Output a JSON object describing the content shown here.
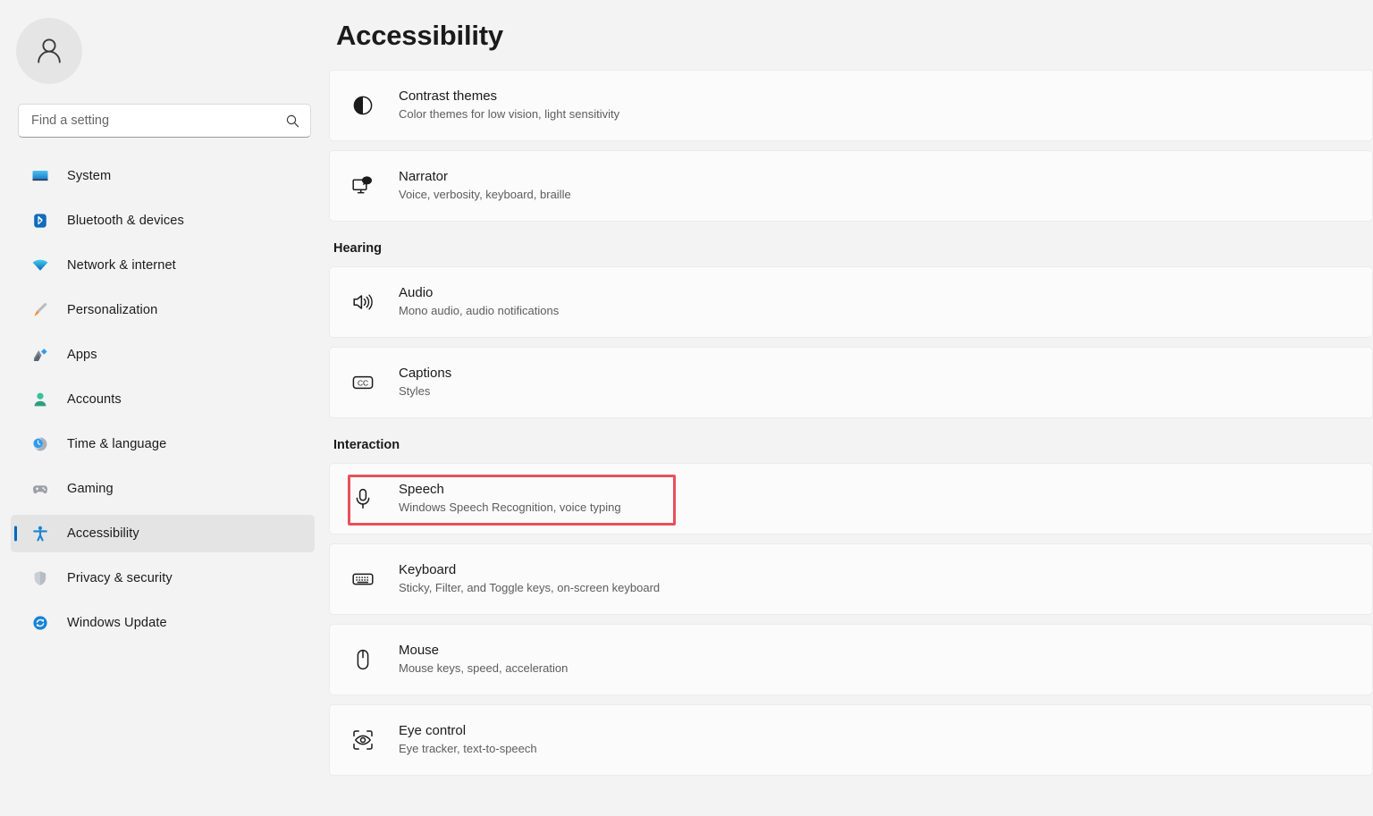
{
  "sidebar": {
    "avatar_icon": "person-avatar-icon",
    "search": {
      "placeholder": "Find a setting",
      "value": "",
      "icon": "search-icon"
    },
    "items": [
      {
        "label": "System",
        "icon": "monitor-icon",
        "selected": false
      },
      {
        "label": "Bluetooth & devices",
        "icon": "bluetooth-icon",
        "selected": false
      },
      {
        "label": "Network & internet",
        "icon": "wifi-icon",
        "selected": false
      },
      {
        "label": "Personalization",
        "icon": "paintbrush-icon",
        "selected": false
      },
      {
        "label": "Apps",
        "icon": "apps-icon",
        "selected": false
      },
      {
        "label": "Accounts",
        "icon": "account-person-icon",
        "selected": false
      },
      {
        "label": "Time & language",
        "icon": "clock-globe-icon",
        "selected": false
      },
      {
        "label": "Gaming",
        "icon": "gamepad-icon",
        "selected": false
      },
      {
        "label": "Accessibility",
        "icon": "accessibility-person-icon",
        "selected": true
      },
      {
        "label": "Privacy & security",
        "icon": "shield-icon",
        "selected": false
      },
      {
        "label": "Windows Update",
        "icon": "update-refresh-icon",
        "selected": false
      }
    ]
  },
  "main": {
    "title": "Accessibility",
    "groups": [
      {
        "header": "",
        "cards": [
          {
            "title": "Contrast themes",
            "subtitle": "Color themes for low vision, light sensitivity",
            "icon": "contrast-circle-icon",
            "highlighted": false
          },
          {
            "title": "Narrator",
            "subtitle": "Voice, verbosity, keyboard, braille",
            "icon": "narrator-monitor-speech-icon",
            "highlighted": false
          }
        ]
      },
      {
        "header": "Hearing",
        "cards": [
          {
            "title": "Audio",
            "subtitle": "Mono audio, audio notifications",
            "icon": "speaker-volume-icon",
            "highlighted": false
          },
          {
            "title": "Captions",
            "subtitle": "Styles",
            "icon": "closed-caption-icon",
            "highlighted": false
          }
        ]
      },
      {
        "header": "Interaction",
        "cards": [
          {
            "title": "Speech",
            "subtitle": "Windows Speech Recognition, voice typing",
            "icon": "microphone-icon",
            "highlighted": true
          },
          {
            "title": "Keyboard",
            "subtitle": "Sticky, Filter, and Toggle keys, on-screen keyboard",
            "icon": "keyboard-icon",
            "highlighted": false
          },
          {
            "title": "Mouse",
            "subtitle": "Mouse keys, speed, acceleration",
            "icon": "mouse-icon",
            "highlighted": false
          },
          {
            "title": "Eye control",
            "subtitle": "Eye tracker, text-to-speech",
            "icon": "eye-control-icon",
            "highlighted": false
          }
        ]
      }
    ]
  },
  "colors": {
    "page_background": "#f3f3f3",
    "card_background": "#fbfbfb",
    "accent": "#0067c0",
    "highlight_red": "#e8505b",
    "selected_item_background": "#e4e4e4"
  }
}
